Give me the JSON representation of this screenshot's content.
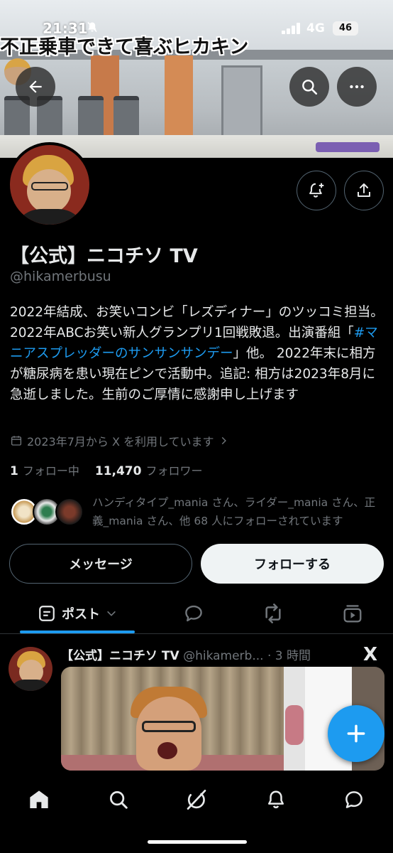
{
  "status_bar": {
    "time": "21:31",
    "network": "4G",
    "battery": "46"
  },
  "banner": {
    "overlay_text": "不正乗車できて喜ぶヒカキン"
  },
  "profile": {
    "name": "【公式】ニコチソ TV",
    "handle": "@hikamerbusu",
    "bio_part1": "2022年結成、お笑いコンビ「レズディナー」のツッコミ担当。 2022年ABCお笑い新人グランプリ1回戦敗退。出演番組「",
    "bio_link": "#マニアスプレッダーのサンサンサンデー",
    "bio_part2": "」他。 2022年末に相方が糖尿病を患い現在ピンで活動中。追記: 相方は2023年8月に急逝しました。生前のご厚情に感謝申し上げます",
    "joined": "2023年7月から X を利用しています",
    "following_count": "1",
    "following_label": "フォロー中",
    "followers_count": "11,470",
    "followers_label": "フォロワー",
    "followed_by_text": "ハンディタイプ_mania さん、ライダー_mania さん、正義_mania さん、他 68 人にフォローされています"
  },
  "actions": {
    "message_label": "メッセージ",
    "follow_label": "フォローする"
  },
  "tabs": {
    "posts_label": "ポスト"
  },
  "post": {
    "author_name": "【公式】ニコチソ TV",
    "author_handle": "@hikamerb...",
    "time": "· 3 時間",
    "logo": "X"
  },
  "colors": {
    "accent": "#1d9bf0",
    "background": "#000000",
    "secondary_text": "#71767b"
  },
  "icons": {
    "back": "arrow-left-icon",
    "search": "search-icon",
    "more": "more-icon",
    "notify": "bell-plus-icon",
    "share": "share-icon",
    "calendar": "calendar-icon",
    "compose": "plus-icon",
    "nav": [
      "home-icon",
      "search-icon",
      "grok-icon",
      "bell-icon",
      "messages-icon"
    ]
  }
}
